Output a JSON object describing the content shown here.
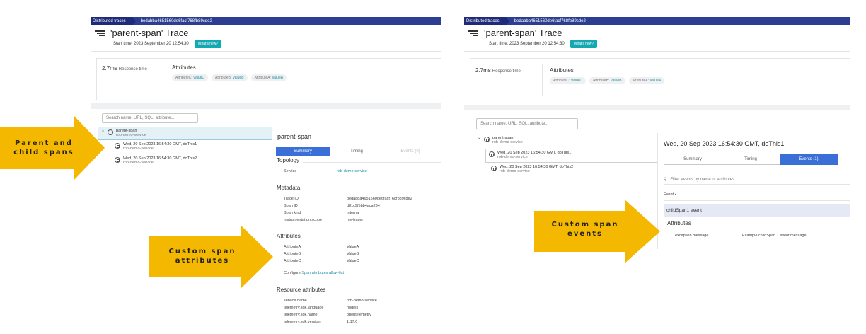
{
  "colors": {
    "callout": "#f5b800",
    "accent_teal": "#14a8b1",
    "tab_active": "#3a6fd8"
  },
  "callouts": {
    "parent_child": [
      "Parent and",
      "child spans"
    ],
    "span_attributes": [
      "Custom span",
      "attributes"
    ],
    "span_events": [
      "Custom span",
      "events"
    ]
  },
  "left": {
    "breadcrumb": {
      "root": "Distributed traces",
      "id": "bedabba4651560de6facf768fb89cde2"
    },
    "title": "'parent-span' Trace",
    "start_time": "Start time: 2023 September 20 12:54:30",
    "whats_new": "What's new?",
    "response_time": {
      "value": "2.7ms",
      "label": "Response time"
    },
    "attributes_title": "Attributes",
    "chips": [
      {
        "key": "AttributeC:",
        "value": "ValueC"
      },
      {
        "key": "AttributeB:",
        "value": "ValueB"
      },
      {
        "key": "AttributeA:",
        "value": "ValueA"
      }
    ],
    "search_placeholder": "Search name, URL, SQL, attribute...",
    "tree": [
      {
        "name": "parent-span",
        "service": "rob-demo-service"
      },
      {
        "name": "Wed, 20 Sep 2023 16:54:30 GMT, doThis1",
        "service": "rob-demo-service"
      },
      {
        "name": "Wed, 20 Sep 2023 16:54:30 GMT, doThis2",
        "service": "rob-demo-service"
      }
    ],
    "detail": {
      "title": "parent-span",
      "tabs": [
        "Summary",
        "Timing",
        "Events (0)"
      ],
      "topology_title": "Topology",
      "topology": {
        "label": "Service",
        "value": "rob-demo-service"
      },
      "metadata_title": "Metadata",
      "metadata": [
        {
          "label": "Trace ID",
          "value": "bedabba4651560de6facf768fb89cde2"
        },
        {
          "label": "Span ID",
          "value": "d81c9f5bb4aca234"
        },
        {
          "label": "Span kind",
          "value": "Internal"
        },
        {
          "label": "Instrumentation scope",
          "value": "my-tracer"
        }
      ],
      "attributes_title": "Attributes",
      "attributes": [
        {
          "label": "AttributeA",
          "value": "ValueA"
        },
        {
          "label": "AttributeB",
          "value": "ValueB"
        },
        {
          "label": "AttributeC",
          "value": "ValueC"
        }
      ],
      "configure_text": "Configure",
      "configure_link": "Span attributes allow-list",
      "resource_title": "Resource attributes",
      "resource": [
        {
          "label": "service.name",
          "value": "rob-demo-service"
        },
        {
          "label": "telemetry.sdk.language",
          "value": "nodejs"
        },
        {
          "label": "telemetry.sdk.name",
          "value": "opentelemetry"
        },
        {
          "label": "telemetry.sdk.version",
          "value": "1.17.0"
        }
      ]
    }
  },
  "right": {
    "breadcrumb": {
      "root": "Distributed traces",
      "id": "bedabba4651560de6facf768fb89cde2"
    },
    "title": "'parent-span' Trace",
    "start_time": "Start time: 2023 September 20 12:54:30",
    "whats_new": "What's new?",
    "response_time": {
      "value": "2.7ms",
      "label": "Response time"
    },
    "attributes_title": "Attributes",
    "chips": [
      {
        "key": "AttributeC:",
        "value": "ValueC"
      },
      {
        "key": "AttributeB:",
        "value": "ValueB"
      },
      {
        "key": "AttributeA:",
        "value": "ValueA"
      }
    ],
    "search_placeholder": "Search name, URL, SQL, attribute...",
    "tree": [
      {
        "name": "parent-span",
        "service": "rob-demo-service"
      },
      {
        "name": "Wed, 20 Sep 2023 16:54:30 GMT, doThis1",
        "service": "rob-demo-service"
      },
      {
        "name": "Wed, 20 Sep 2023 16:54:30 GMT, doThis2",
        "service": "rob-demo-service"
      }
    ],
    "detail": {
      "title": "Wed, 20 Sep 2023 16:54:30 GMT, doThis1",
      "tabs": [
        "Summary",
        "Timing",
        "Events (1)"
      ],
      "filter_placeholder": "Filter events by name or attributes",
      "event_header": "Event ▴",
      "event": "childSpan1 event",
      "attributes_title": "Attributes",
      "attribute": {
        "label": "exception.message",
        "value": "Example childSpan 1 event message"
      }
    }
  }
}
